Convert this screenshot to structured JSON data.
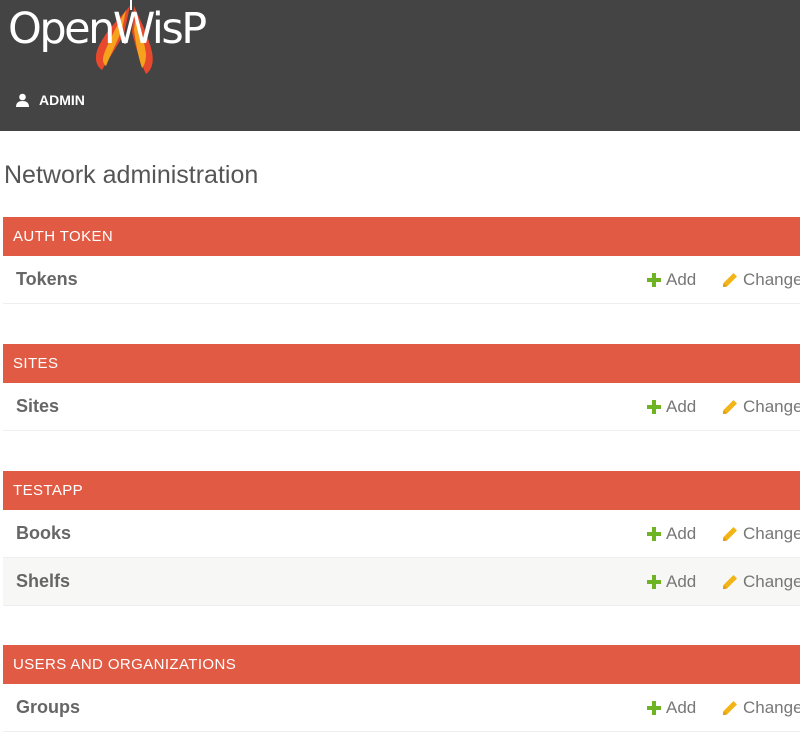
{
  "header": {
    "logo_text": "OpenWisP",
    "user_label": "ADMIN"
  },
  "page_title": "Network administration",
  "actions": {
    "add_label": "Add",
    "change_label": "Change"
  },
  "modules": [
    {
      "caption": "AUTH TOKEN",
      "models": [
        {
          "name": "Tokens"
        }
      ]
    },
    {
      "caption": "SITES",
      "models": [
        {
          "name": "Sites"
        }
      ]
    },
    {
      "caption": "TESTAPP",
      "models": [
        {
          "name": "Books"
        },
        {
          "name": "Shelfs"
        }
      ]
    },
    {
      "caption": "USERS AND ORGANIZATIONS",
      "models": [
        {
          "name": "Groups"
        }
      ]
    }
  ],
  "colors": {
    "header_bg": "#444444",
    "caption_bg": "#e15b44",
    "add_icon": "#6eb323",
    "change_icon": "#f2b417",
    "logo_accent": "#e8492c"
  },
  "icons": {
    "user": "user-icon",
    "add": "plus-icon",
    "change": "pencil-icon"
  }
}
